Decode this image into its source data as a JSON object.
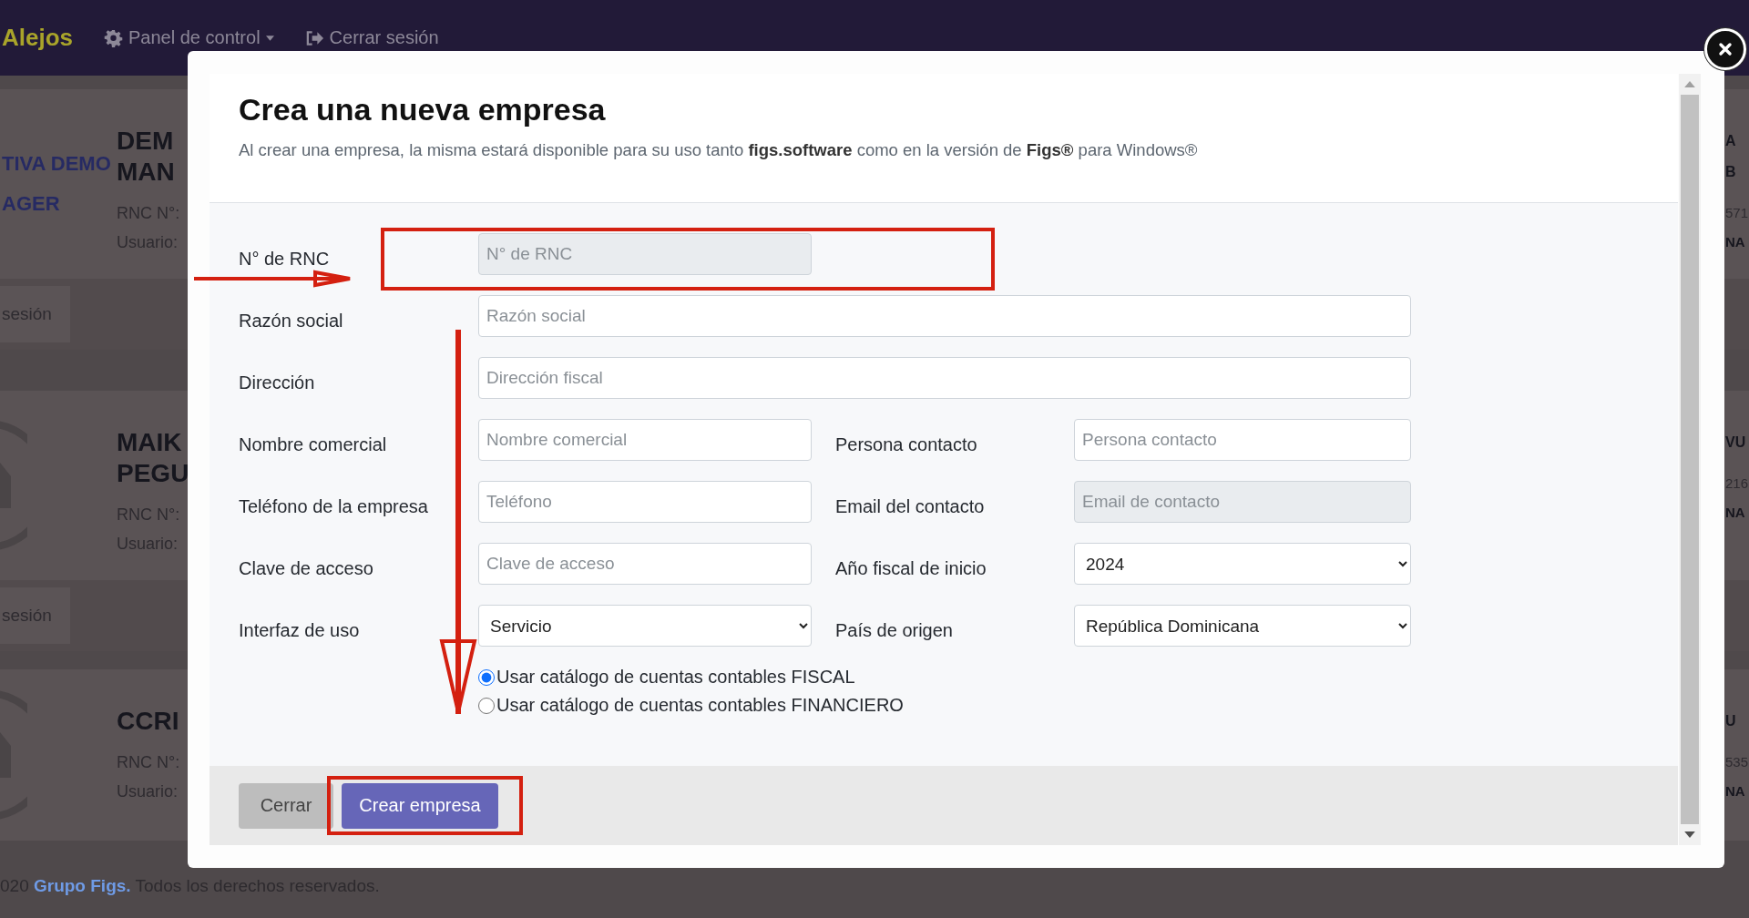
{
  "navbar": {
    "brand": "Alejos",
    "items": [
      {
        "label": "Panel de control",
        "kind": "dropdown"
      },
      {
        "label": "Cerrar sesión",
        "kind": "logout"
      }
    ]
  },
  "background_cards": [
    {
      "logo_lines": [
        "TIVA DEMO",
        "AGER"
      ],
      "title_lines": [
        "DEM",
        "MAN"
      ],
      "rnc": "RNC N°:",
      "user": "Usuario:",
      "button": "sesión",
      "right_title_lines": [
        "A",
        "B"
      ],
      "right_rnc": "571",
      "right_user": "NA"
    },
    {
      "title_lines": [
        "MAIK",
        "PEGU"
      ],
      "rnc": "RNC N°:",
      "user": "Usuario:",
      "button": "sesión",
      "right_title_lines": [
        "VU"
      ],
      "right_rnc": "216",
      "right_user": "NA"
    },
    {
      "title_lines": [
        "CCRI"
      ],
      "rnc": "RNC N°:",
      "user": "Usuario:",
      "right_title_lines": [
        "U"
      ],
      "right_rnc": "535",
      "right_user": "NA"
    }
  ],
  "footer": {
    "prefix": "020",
    "link": "Grupo Figs.",
    "suffix": "Todos los derechos reservados."
  },
  "modal": {
    "title": "Crea una nueva empresa",
    "subtitle": "Al crear una empresa, la misma estará disponible para su uso tanto **figs.software** como en la versión de **Figs®** para Windows®",
    "rows": [
      {
        "fields": [
          {
            "label": "N° de RNC",
            "kind": "input",
            "placeholder": "N° de RNC",
            "disabled": true
          }
        ]
      },
      {
        "fields": [
          {
            "label": "Razón social",
            "kind": "wide-input",
            "placeholder": "Razón social",
            "disabled": false
          }
        ]
      },
      {
        "fields": [
          {
            "label": "Dirección",
            "kind": "wide-input",
            "placeholder": "Dirección fiscal",
            "disabled": false
          }
        ]
      },
      {
        "fields": [
          {
            "label": "Nombre comercial",
            "kind": "input",
            "placeholder": "Nombre comercial",
            "disabled": false
          },
          {
            "label": "Persona contacto",
            "kind": "input",
            "placeholder": "Persona contacto",
            "disabled": false
          }
        ]
      },
      {
        "fields": [
          {
            "label": "Teléfono de la empresa",
            "kind": "input",
            "placeholder": "Teléfono",
            "disabled": false
          },
          {
            "label": "Email del contacto",
            "kind": "input",
            "placeholder": "Email de contacto",
            "disabled": true
          }
        ]
      },
      {
        "fields": [
          {
            "label": "Clave de acceso",
            "kind": "input",
            "placeholder": "Clave de acceso",
            "disabled": false
          },
          {
            "label": "Año fiscal de inicio",
            "kind": "select",
            "value": "2024",
            "disabled": false
          }
        ]
      },
      {
        "fields": [
          {
            "label": "Interfaz de uso",
            "kind": "select",
            "value": "Servicio",
            "disabled": false
          },
          {
            "label": "País de origen",
            "kind": "select",
            "value": "República Dominicana",
            "disabled": false
          }
        ]
      }
    ],
    "radios": [
      {
        "label": "Usar catálogo de cuentas contables FISCAL",
        "selected": true
      },
      {
        "label": "Usar catálogo de cuentas contables FINANCIERO",
        "selected": false
      }
    ],
    "buttons": [
      {
        "label": "Cerrar",
        "kind": "secondary"
      },
      {
        "label": "Crear empresa",
        "kind": "primary"
      }
    ]
  }
}
